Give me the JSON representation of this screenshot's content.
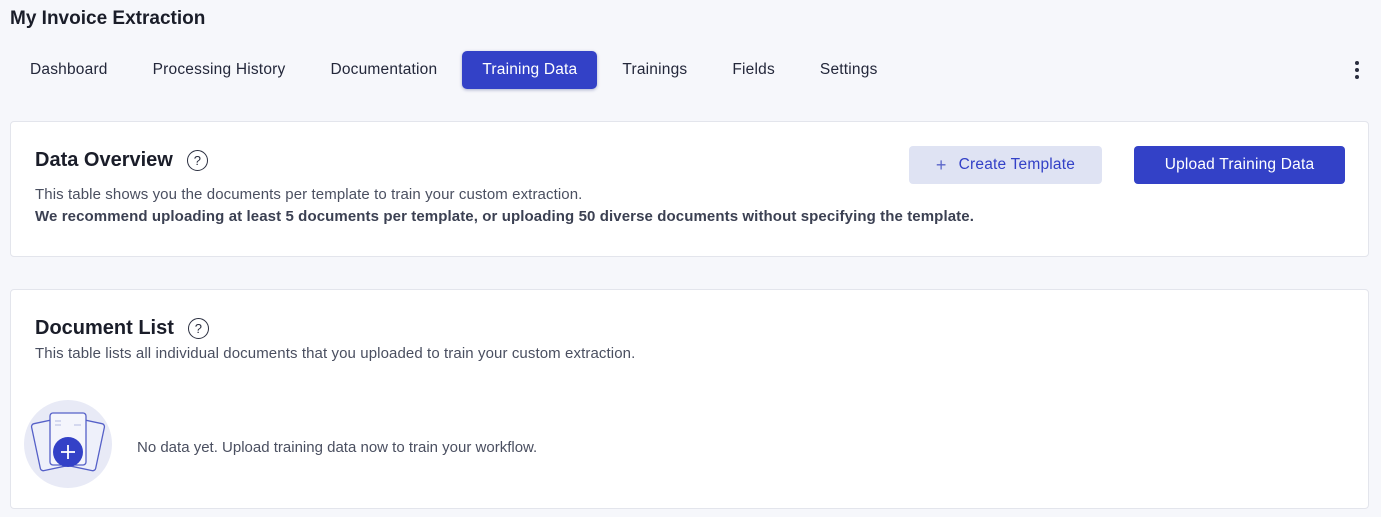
{
  "app": {
    "title": "My Invoice Extraction"
  },
  "tabs": [
    {
      "label": "Dashboard",
      "active": false
    },
    {
      "label": "Processing History",
      "active": false
    },
    {
      "label": "Documentation",
      "active": false
    },
    {
      "label": "Training Data",
      "active": true
    },
    {
      "label": "Trainings",
      "active": false
    },
    {
      "label": "Fields",
      "active": false
    },
    {
      "label": "Settings",
      "active": false
    }
  ],
  "overview": {
    "title": "Data Overview",
    "help_icon": "?",
    "description": "This table shows you the documents per template to train your custom extraction.",
    "recommendation": "We recommend uploading at least 5 documents per template, or uploading 50 diverse documents without specifying the template.",
    "create_button": {
      "icon": "+",
      "label": "Create Template"
    },
    "upload_button": {
      "label": "Upload Training Data"
    }
  },
  "document_list": {
    "title": "Document List",
    "help_icon": "?",
    "description": "This table lists all individual documents that you uploaded to train your custom extraction.",
    "empty_message": "No data yet. Upload training data now to train your workflow."
  },
  "colors": {
    "accent": "#3341c7",
    "accent_light": "#dfe3f3",
    "background": "#f6f7fb"
  }
}
